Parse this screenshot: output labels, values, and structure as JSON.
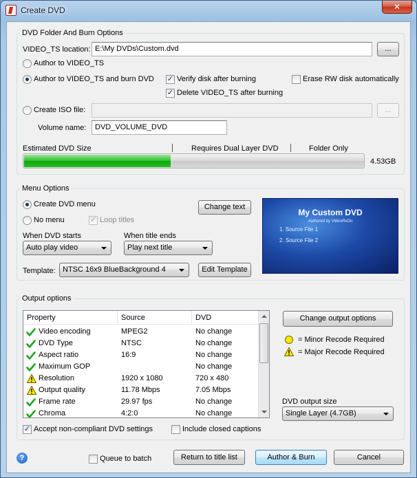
{
  "window": {
    "title": "Create DVD",
    "close_symbol": "✕"
  },
  "dvd_folder": {
    "group_title": "DVD Folder And Burn Options",
    "video_ts_label": "VIDEO_TS location:",
    "video_ts_value": "E:\\My DVDs\\Custom.dvd",
    "browse_label": "...",
    "author_video_ts": "Author to VIDEO_TS",
    "author_and_burn": "Author to VIDEO_TS and burn DVD",
    "verify_label": "Verify disk after burning",
    "delete_label": "Delete VIDEO_TS after burning",
    "erase_label": "Erase RW disk automatically",
    "create_iso_label": "Create ISO file:",
    "iso_value": "",
    "iso_browse_label": "...",
    "volume_name_label": "Volume name:",
    "volume_name_value": "DVD_VOLUME_DVD",
    "estimate_label": "Estimated DVD Size",
    "dual_layer_label": "Requires Dual Layer DVD",
    "folder_only_label": "Folder Only",
    "size_value": "4.53GB",
    "size_fraction": 0.43
  },
  "menu": {
    "group_title": "Menu Options",
    "create_menu_label": "Create DVD menu",
    "no_menu_label": "No menu",
    "loop_titles_label": "Loop titles",
    "change_text_label": "Change text",
    "when_starts_label": "When DVD starts",
    "when_starts_value": "Auto play video",
    "when_ends_label": "When title ends",
    "when_ends_value": "Play next title",
    "template_label": "Template:",
    "template_value": "NTSC 16x9 BlueBackground 4",
    "edit_template_label": "Edit Template",
    "preview": {
      "title": "My Custom DVD",
      "subtitle": "Authored by VideoReDo",
      "items": [
        "1. Source File 1",
        "2. Source File 2"
      ]
    }
  },
  "output": {
    "group_title": "Output options",
    "columns": [
      "Property",
      "Source",
      "DVD"
    ],
    "rows": [
      {
        "status": "ok",
        "property": "Video encoding",
        "source": "MPEG2",
        "dvd": "No change"
      },
      {
        "status": "ok",
        "property": "DVD Type",
        "source": "NTSC",
        "dvd": "No change"
      },
      {
        "status": "ok",
        "property": "Aspect ratio",
        "source": "16:9",
        "dvd": "No change"
      },
      {
        "status": "ok",
        "property": "Maximum GOP",
        "source": "",
        "dvd": "No change"
      },
      {
        "status": "major",
        "property": "Resolution",
        "source": "1920 x 1080",
        "dvd": "720 x 480"
      },
      {
        "status": "major",
        "property": "Output quality",
        "source": "11.78 Mbps",
        "dvd": "7.05 Mbps"
      },
      {
        "status": "ok",
        "property": "Frame rate",
        "source": "29.97 fps",
        "dvd": "No change"
      },
      {
        "status": "ok",
        "property": "Chroma",
        "source": "4:2:0",
        "dvd": "No change"
      }
    ],
    "change_output_label": "Change output options",
    "minor_label": "= Minor Recode Required",
    "major_label": "= Major Recode Required",
    "dvd_output_size_label": "DVD output size",
    "dvd_output_size_value": "Single Layer (4.7GB)",
    "accept_label": "Accept non-compliant DVD settings",
    "captions_label": "Include closed captions"
  },
  "footer": {
    "help_symbol": "?",
    "queue_label": "Queue to batch",
    "return_label": "Return to title list",
    "author_burn_label": "Author & Burn",
    "cancel_label": "Cancel"
  },
  "colors": {
    "progress_green": "#22b922",
    "preview_blue": "#1d4aa8",
    "ok_green": "#1fa31f",
    "warn_yellow": "#ffe800"
  }
}
